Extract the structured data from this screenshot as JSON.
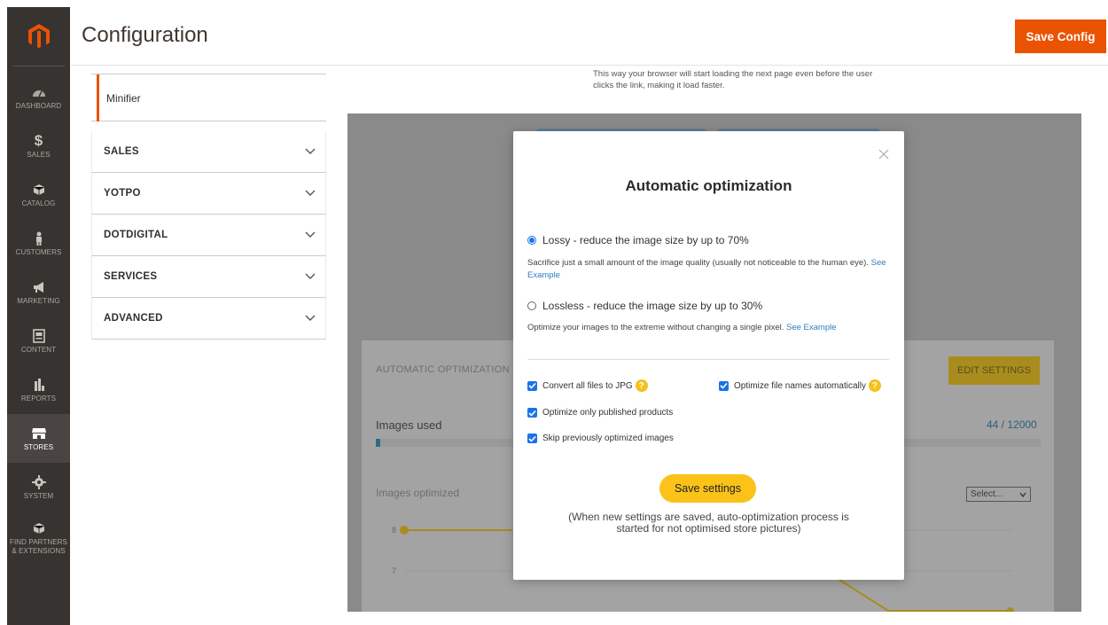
{
  "admin_menu": {
    "items": [
      {
        "label": "DASHBOARD",
        "icon": "dashboard-icon"
      },
      {
        "label": "SALES",
        "icon": "dollar-icon"
      },
      {
        "label": "CATALOG",
        "icon": "box-icon"
      },
      {
        "label": "CUSTOMERS",
        "icon": "person-icon"
      },
      {
        "label": "MARKETING",
        "icon": "megaphone-icon"
      },
      {
        "label": "CONTENT",
        "icon": "content-icon"
      },
      {
        "label": "REPORTS",
        "icon": "bar-chart-icon"
      },
      {
        "label": "STORES",
        "icon": "store-icon",
        "active": true
      },
      {
        "label": "SYSTEM",
        "icon": "gear-icon"
      },
      {
        "label1": "FIND PARTNERS",
        "label2": "& EXTENSIONS",
        "icon": "cube-icon"
      }
    ]
  },
  "header": {
    "title": "Configuration",
    "save_label": "Save Config",
    "accent": "#eb5202"
  },
  "config_tabs": {
    "active_item": "Minifier",
    "groups": [
      "SALES",
      "YOTPO",
      "DOTDIGITAL",
      "SERVICES",
      "ADVANCED"
    ]
  },
  "description": {
    "line1": "This way your browser will start loading the next page even before the user",
    "line2": "clicks the link, making it load faster."
  },
  "background_panel": {
    "section_title": "AUTOMATIC OPTIMIZATION",
    "edit_label": "EDIT SETTINGS",
    "images_used_label": "Images used",
    "images_used_value": "44 / 12000",
    "images_used_fraction": 0.0037,
    "images_optimized_label": "Images optimized",
    "select_label": "Select...",
    "axis_8": "8",
    "axis_7": "7"
  },
  "modal": {
    "title": "Automatic optimization",
    "lossy_label": "Lossy - reduce the image size by up to 70%",
    "lossy_desc": "Sacrifice just a small amount of the image quality (usually not noticeable to the human eye).",
    "lossy_link": "See Example",
    "lossless_label": "Lossless - reduce the image size by up to 30%",
    "lossless_desc": "Optimize your images to the extreme without changing a single pixel.",
    "lossless_link": "See Example",
    "cb_jpg": "Convert all files to JPG",
    "cb_filenames": "Optimize file names automatically",
    "cb_published": "Optimize only published products",
    "cb_skip": "Skip previously optimized images",
    "help_glyph": "?",
    "save_label": "Save settings",
    "note_line1": "(When new settings are saved, auto-optimization process is",
    "note_line2": "started for not optimised store pictures)",
    "selected_mode": "lossy"
  }
}
